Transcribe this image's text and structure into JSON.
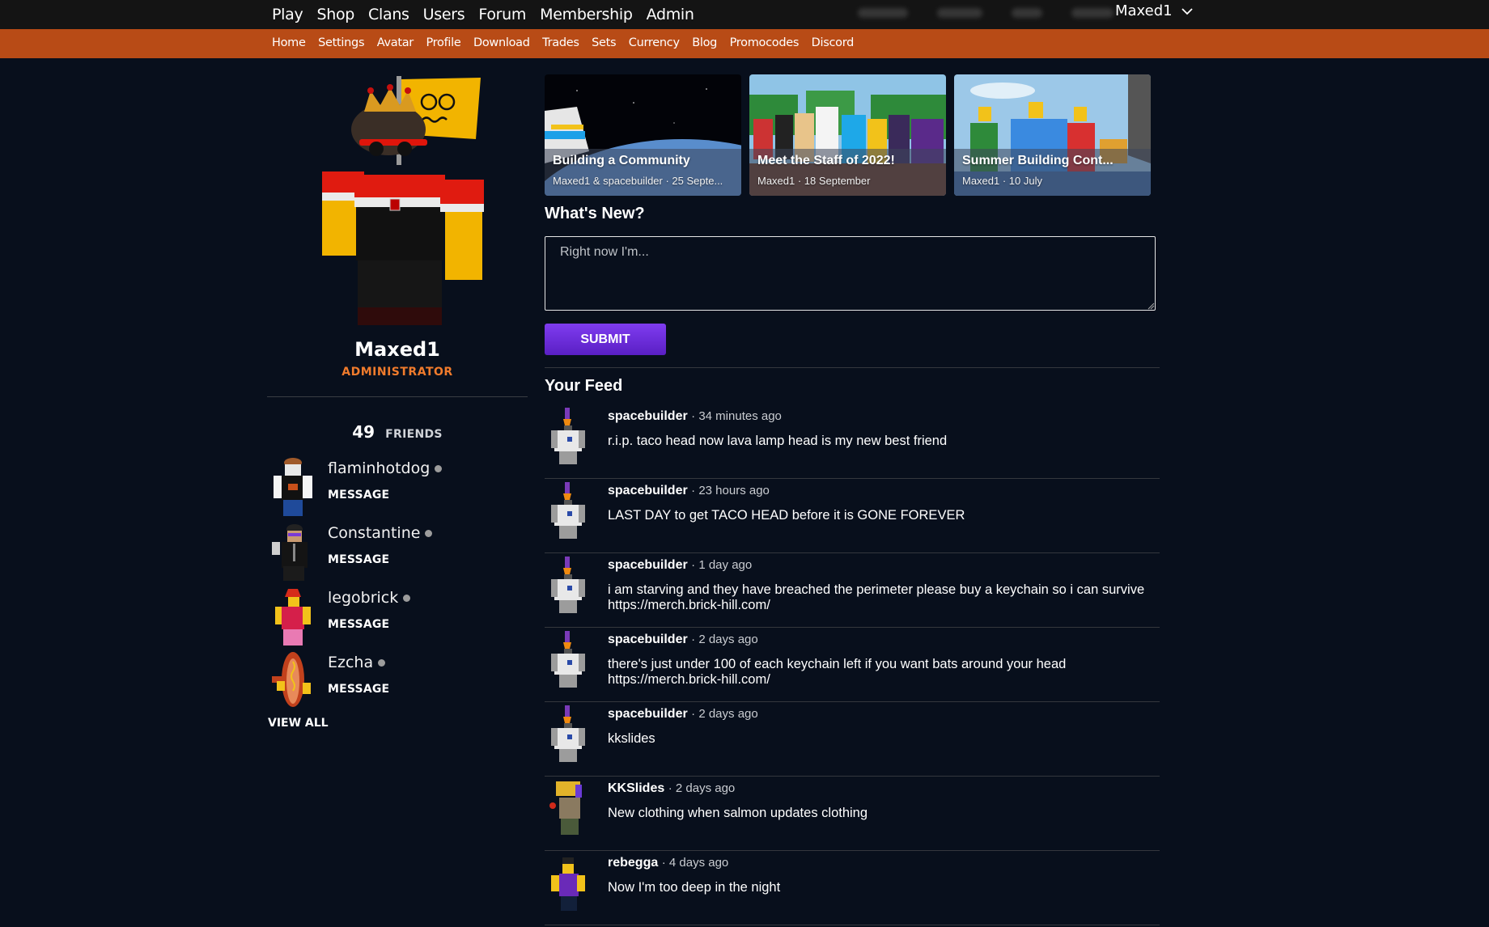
{
  "topnav": {
    "items": [
      "Play",
      "Shop",
      "Clans",
      "Users",
      "Forum",
      "Membership",
      "Admin"
    ],
    "username": "Maxed1",
    "dropdown_icon": "chevron-down-icon"
  },
  "subnav": {
    "items": [
      "Home",
      "Settings",
      "Avatar",
      "Profile",
      "Download",
      "Trades",
      "Sets",
      "Currency",
      "Blog",
      "Promocodes",
      "Discord"
    ]
  },
  "colors": {
    "background": "#080f1c",
    "topbar": "#141414",
    "subbar": "#b84b16",
    "role_accent": "#f07b2c",
    "submit_button": "#6a2ee0"
  },
  "profile": {
    "name": "Maxed1",
    "role": "ADMINISTRATOR",
    "friends_count": "49",
    "friends_label": "FRIENDS",
    "friends": [
      {
        "name": "flaminhotdog",
        "action": "MESSAGE"
      },
      {
        "name": "Constantine",
        "action": "MESSAGE"
      },
      {
        "name": "legobrick",
        "action": "MESSAGE"
      },
      {
        "name": "Ezcha",
        "action": "MESSAGE"
      }
    ],
    "view_all": "VIEW ALL"
  },
  "blog_cards": [
    {
      "title": "Building a Community",
      "meta": "Maxed1 & spacebuilder · 25 Septe..."
    },
    {
      "title": "Meet the Staff of 2022!",
      "meta": "Maxed1 · 18 September"
    },
    {
      "title": "Summer Building Cont...",
      "meta": "Maxed1 · 10 July"
    }
  ],
  "whats_new": {
    "title": "What's New?",
    "placeholder": "Right now I'm...",
    "value": "",
    "submit_label": "SUBMIT"
  },
  "feed": {
    "title": "Your Feed",
    "items": [
      {
        "user": "spacebuilder",
        "time": "34 minutes ago",
        "text": "r.i.p. taco head now lava lamp head is my new best friend"
      },
      {
        "user": "spacebuilder",
        "time": "23 hours ago",
        "text": "LAST DAY to get TACO HEAD before it is GONE FOREVER"
      },
      {
        "user": "spacebuilder",
        "time": "1 day ago",
        "text": "i am starving and they have breached the perimeter please buy a keychain so i can survive https://merch.brick-hill.com/"
      },
      {
        "user": "spacebuilder",
        "time": "2 days ago",
        "text": "there's just under 100 of each keychain left if you want bats around your head https://merch.brick-hill.com/"
      },
      {
        "user": "spacebuilder",
        "time": "2 days ago",
        "text": "kkslides"
      },
      {
        "user": "KKSlides",
        "time": "2 days ago",
        "text": "New clothing when salmon updates clothing"
      },
      {
        "user": "rebegga",
        "time": "4 days ago",
        "text": "Now I'm too deep in the night"
      }
    ]
  }
}
